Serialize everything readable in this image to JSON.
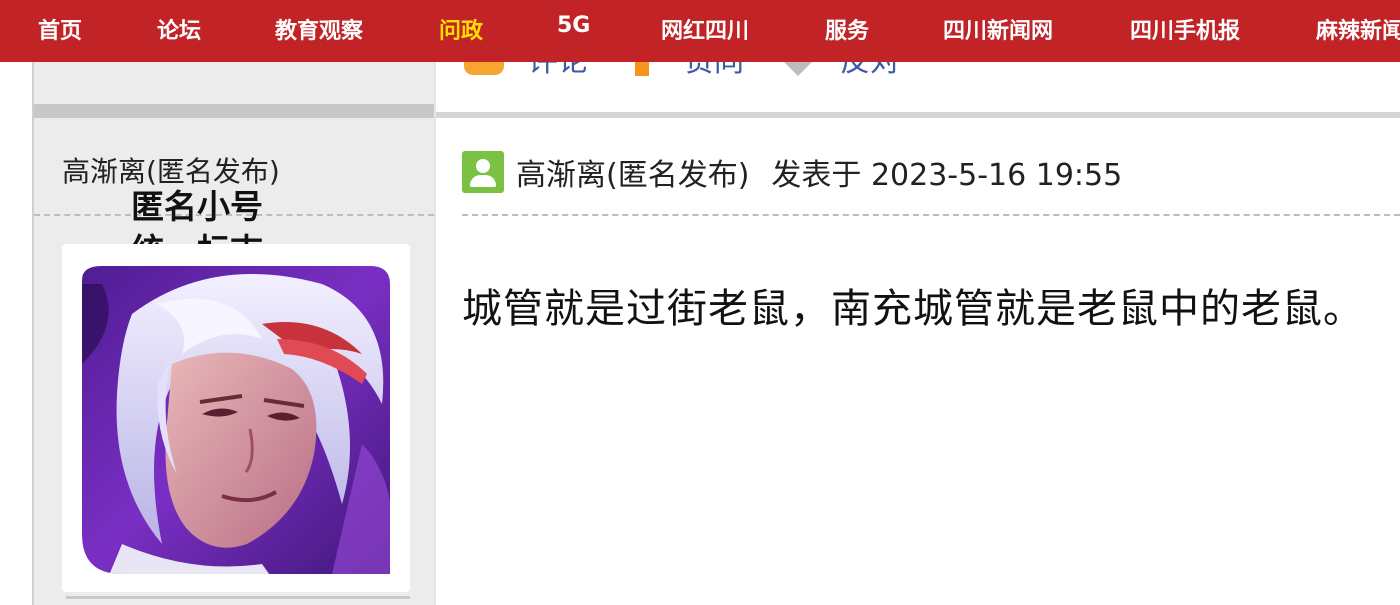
{
  "nav": {
    "items": [
      {
        "label": "首页",
        "active": false
      },
      {
        "label": "论坛",
        "active": false
      },
      {
        "label": "教育观察",
        "active": false
      },
      {
        "label": "问政",
        "active": true
      },
      {
        "label": "5G",
        "active": false
      },
      {
        "label": "网红四川",
        "active": false
      },
      {
        "label": "服务",
        "active": false
      },
      {
        "label": "四川新闻网",
        "active": false
      },
      {
        "label": "四川手机报",
        "active": false
      },
      {
        "label": "麻辣新闻",
        "active": false
      }
    ],
    "bg_color": "#c12326",
    "active_color": "#ffe000"
  },
  "previous_post_actions": {
    "comment_label": "评论",
    "upvote_label": "赞同",
    "downvote_label": "反对",
    "icons": [
      "comment-icon",
      "arrow-up-icon",
      "arrow-down-icon"
    ]
  },
  "author_panel": {
    "name": "高渐离(匿名发布)",
    "badge_line1": "匿名小号",
    "badge_line2": "统一标志",
    "avatar_description": "anime-avatar"
  },
  "post": {
    "author": "高渐离(匿名发布)",
    "posted_at": "发表于 2023-5-16 19:55",
    "content": "城管就是过街老鼠，南充城管就是老鼠中的老鼠。",
    "user_icon": "user-icon"
  }
}
